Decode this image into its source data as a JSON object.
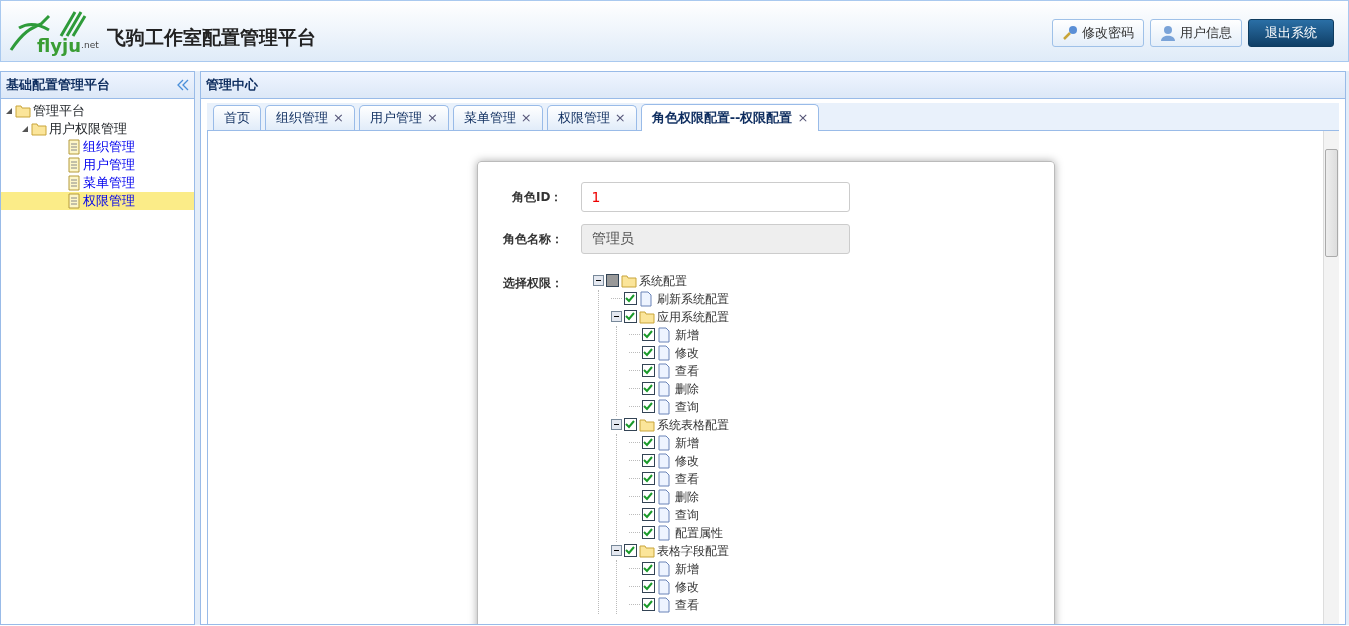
{
  "header": {
    "logo": {
      "text": "flyju",
      "suffix": ".net"
    },
    "title": "飞驹工作室配置管理平台",
    "buttons": [
      {
        "label": "修改密码",
        "kind": "key"
      },
      {
        "label": "用户信息",
        "kind": "user"
      },
      {
        "label": "退出系统",
        "kind": "primary"
      }
    ]
  },
  "sidebar": {
    "title": "基础配置管理平台",
    "tree": [
      {
        "label": "管理平台",
        "expanded": true,
        "selected": false,
        "children": [
          {
            "label": "用户权限管理",
            "expanded": true,
            "selected": false,
            "children": [
              {
                "label": "组织管理",
                "selected": false
              },
              {
                "label": "用户管理",
                "selected": false
              },
              {
                "label": "菜单管理",
                "selected": false
              },
              {
                "label": "权限管理",
                "selected": true
              }
            ]
          }
        ]
      }
    ]
  },
  "main": {
    "title": "管理中心",
    "tabs": [
      {
        "label": "首页",
        "closable": false,
        "selected": false
      },
      {
        "label": "组织管理",
        "closable": true,
        "selected": false
      },
      {
        "label": "用户管理",
        "closable": true,
        "selected": false
      },
      {
        "label": "菜单管理",
        "closable": true,
        "selected": false
      },
      {
        "label": "权限管理",
        "closable": true,
        "selected": false
      },
      {
        "label": "角色权限配置--权限配置",
        "closable": true,
        "selected": true
      }
    ],
    "tab_close": "×",
    "form": {
      "role_id": {
        "label": "角色ID：",
        "value": "1",
        "disabled": false
      },
      "role_name": {
        "label": "角色名称：",
        "value": "管理员",
        "disabled": true
      },
      "permissions_label": "选择权限：",
      "tree": [
        {
          "label": "系统配置",
          "checked": false,
          "partial": true,
          "expanded": true,
          "children": [
            {
              "label": "刷新系统配置",
              "checked": true
            },
            {
              "label": "应用系统配置",
              "checked": true,
              "expanded": true,
              "children": [
                {
                  "label": "新增",
                  "checked": true
                },
                {
                  "label": "修改",
                  "checked": true
                },
                {
                  "label": "查看",
                  "checked": true
                },
                {
                  "label": "删除",
                  "checked": true
                },
                {
                  "label": "查询",
                  "checked": true
                }
              ]
            },
            {
              "label": "系统表格配置",
              "checked": true,
              "expanded": true,
              "children": [
                {
                  "label": "新增",
                  "checked": true
                },
                {
                  "label": "修改",
                  "checked": true
                },
                {
                  "label": "查看",
                  "checked": true
                },
                {
                  "label": "删除",
                  "checked": true
                },
                {
                  "label": "查询",
                  "checked": true
                },
                {
                  "label": "配置属性",
                  "checked": true
                }
              ]
            },
            {
              "label": "表格字段配置",
              "checked": true,
              "expanded": true,
              "children": [
                {
                  "label": "新增",
                  "checked": true
                },
                {
                  "label": "修改",
                  "checked": true
                },
                {
                  "label": "查看",
                  "checked": true
                }
              ]
            }
          ]
        }
      ]
    }
  }
}
